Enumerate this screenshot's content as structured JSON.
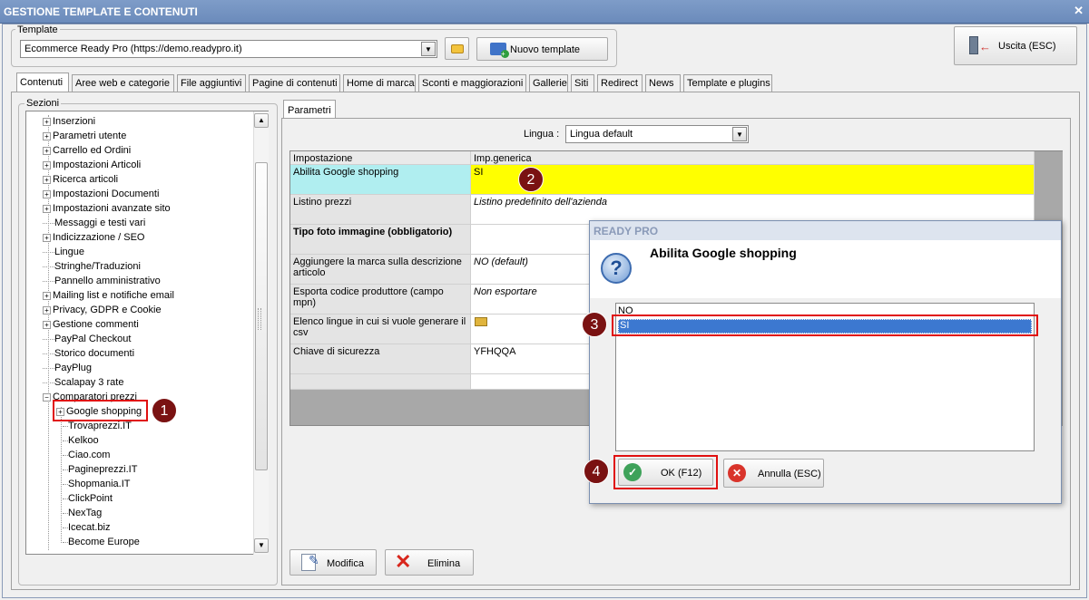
{
  "window": {
    "title": "GESTIONE TEMPLATE E CONTENUTI",
    "close": "✕"
  },
  "template": {
    "group_label": "Template",
    "selected": "Ecommerce Ready Pro (https://demo.readypro.it)",
    "new_button": "Nuovo template"
  },
  "exit_button": "Uscita (ESC)",
  "tabs": [
    "Contenuti",
    "Aree web e categorie",
    "File aggiuntivi",
    "Pagine di contenuti",
    "Home di marca",
    "Sconti e maggiorazioni",
    "Gallerie",
    "Siti",
    "Redirect",
    "News",
    "Template e plugins"
  ],
  "sections": {
    "group_label": "Sezioni",
    "items": [
      {
        "label": "Inserzioni",
        "exp": "+"
      },
      {
        "label": "Parametri utente",
        "exp": "+"
      },
      {
        "label": "Carrello ed Ordini",
        "exp": "+"
      },
      {
        "label": "Impostazioni Articoli",
        "exp": "+"
      },
      {
        "label": "Ricerca articoli",
        "exp": "+"
      },
      {
        "label": "Impostazioni Documenti",
        "exp": "+"
      },
      {
        "label": "Impostazioni avanzate sito",
        "exp": "+"
      },
      {
        "label": "Messaggi e testi vari",
        "exp": ""
      },
      {
        "label": "Indicizzazione / SEO",
        "exp": "+"
      },
      {
        "label": "Lingue",
        "exp": ""
      },
      {
        "label": "Stringhe/Traduzioni",
        "exp": ""
      },
      {
        "label": "Pannello amministrativo",
        "exp": ""
      },
      {
        "label": "Mailing list e notifiche email",
        "exp": "+"
      },
      {
        "label": "Privacy, GDPR e Cookie",
        "exp": "+"
      },
      {
        "label": "Gestione commenti",
        "exp": "+"
      },
      {
        "label": "PayPal Checkout",
        "exp": ""
      },
      {
        "label": "Storico documenti",
        "exp": ""
      },
      {
        "label": "PayPlug",
        "exp": ""
      },
      {
        "label": "Scalapay 3 rate",
        "exp": ""
      },
      {
        "label": "Comparatori prezzi",
        "exp": "−"
      }
    ],
    "children": [
      "Google shopping",
      "Trovaprezzi.IT",
      "Kelkoo",
      "Ciao.com",
      "Pagineprezzi.IT",
      "Shopmania.IT",
      "ClickPoint",
      "NexTag",
      "Icecat.biz",
      "Become Europe"
    ]
  },
  "params": {
    "tab": "Parametri",
    "lingua_label": "Lingua :",
    "lingua_value": "Lingua default",
    "col_setting": "Impostazione",
    "col_value": "Imp.generica",
    "rows": [
      {
        "label": "Abilita Google shopping",
        "value": "SI"
      },
      {
        "label": "Listino prezzi",
        "value": "Listino predefinito dell'azienda"
      },
      {
        "label": "Tipo foto immagine (obbligatorio)",
        "value": ""
      },
      {
        "label": "Aggiungere la marca sulla descrizione articolo",
        "value": "NO (default)"
      },
      {
        "label": "Esporta codice produttore (campo mpn)",
        "value": "Non esportare"
      },
      {
        "label": "Elenco lingue in cui si vuole generare il csv",
        "value": ""
      },
      {
        "label": "Chiave di sicurezza",
        "value": "YFHQQA"
      }
    ]
  },
  "bottom": {
    "edit": "Modifica",
    "delete": "Elimina"
  },
  "dialog": {
    "title": "READY PRO",
    "heading": "Abilita Google shopping",
    "options": [
      "NO",
      "SI"
    ],
    "ok": "OK (F12)",
    "cancel": "Annulla (ESC)"
  },
  "badges": [
    "1",
    "2",
    "3",
    "4"
  ],
  "colors": {
    "highlight_yellow": "#ffff00",
    "selected_row": "#b0eef0",
    "list_selected": "#3c78d0",
    "annotation_red": "#e01010"
  }
}
